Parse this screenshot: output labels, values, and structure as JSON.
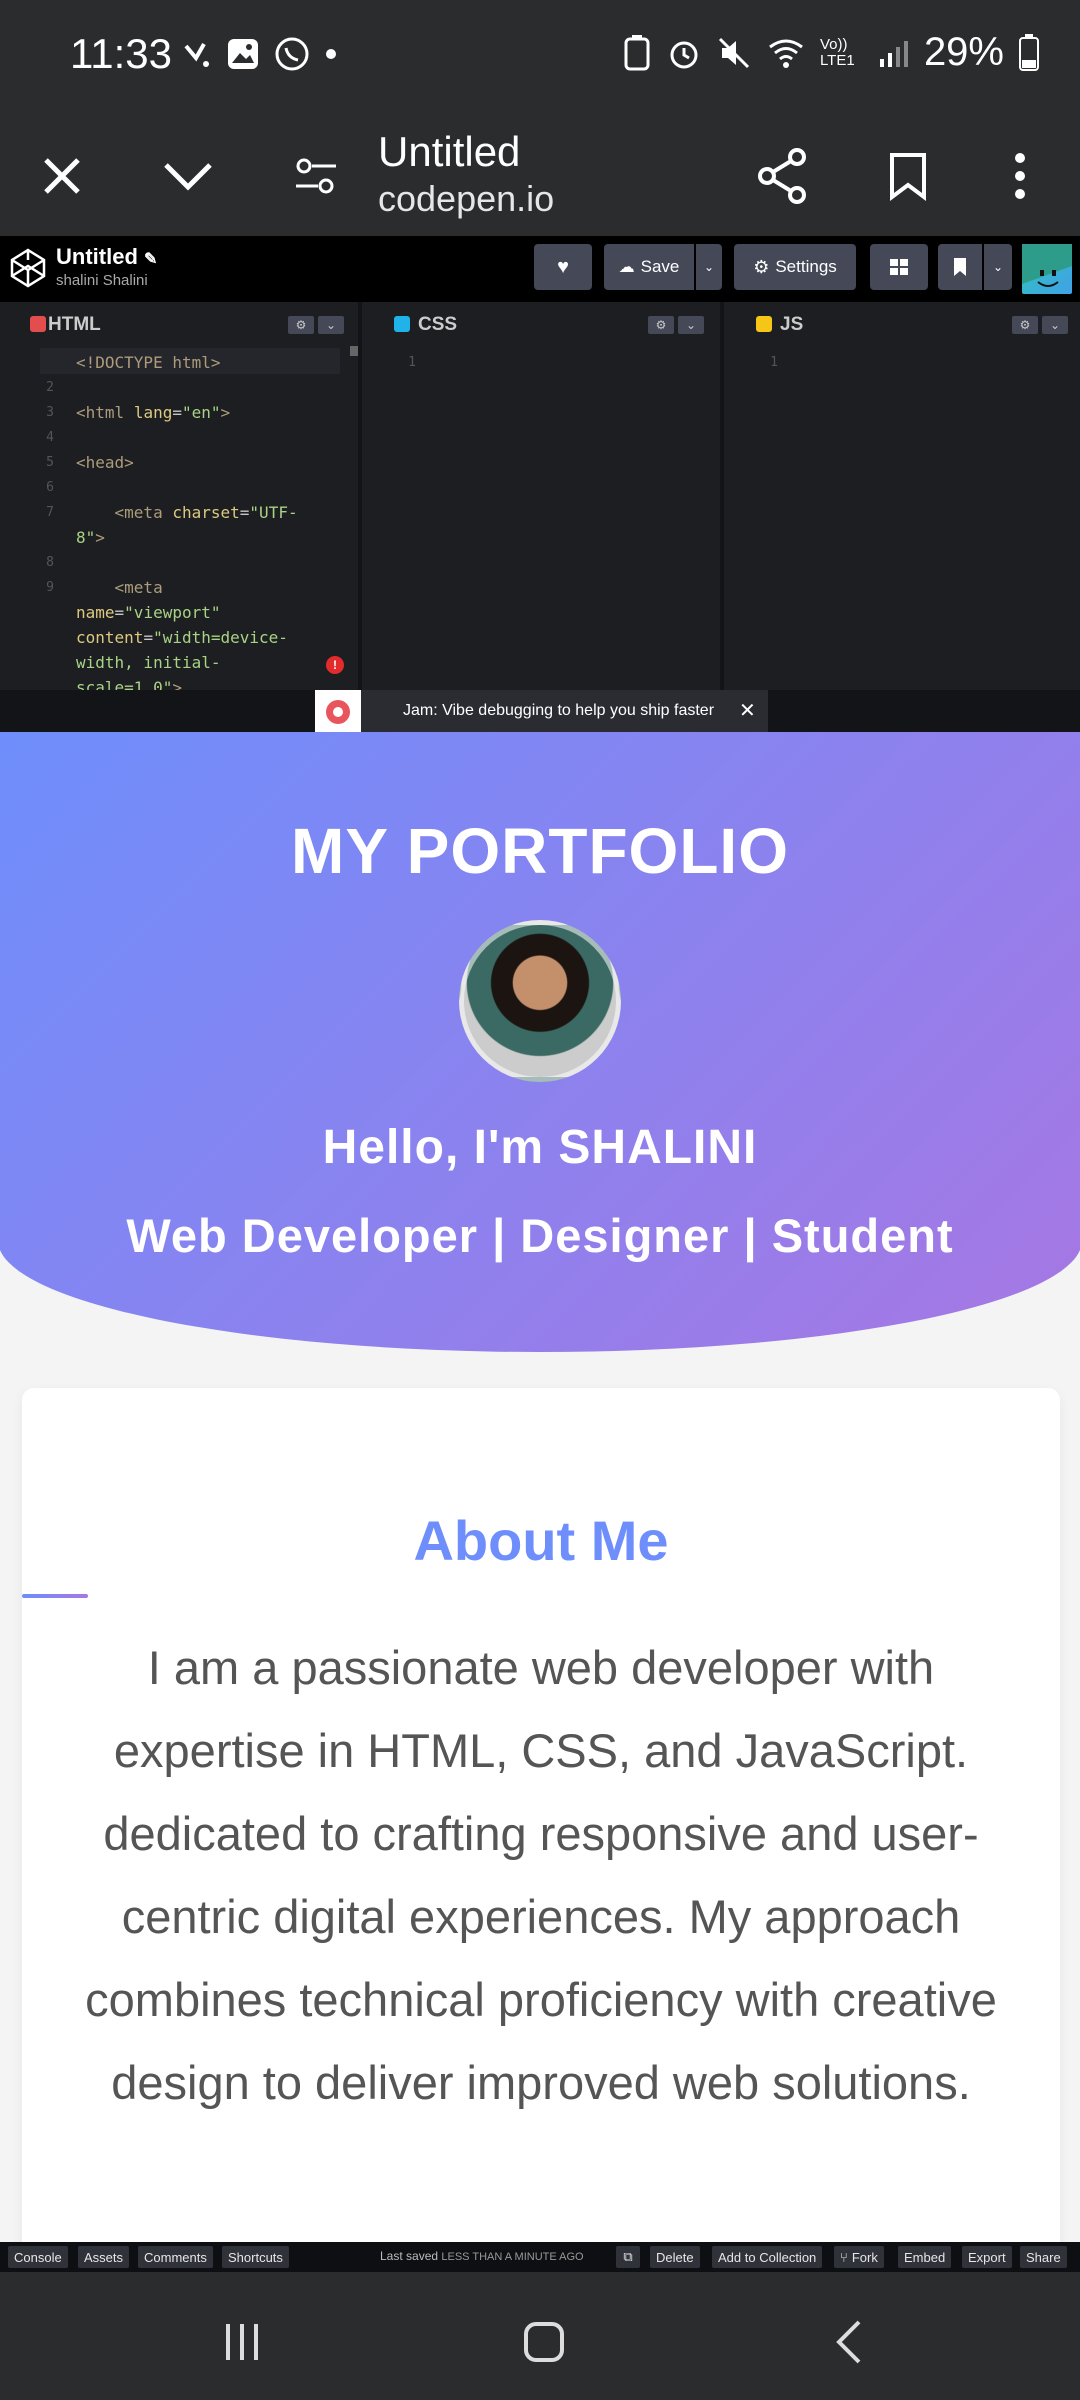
{
  "status": {
    "time": "11:33",
    "battery": "29%",
    "network": "Vo)) LTE1"
  },
  "browser": {
    "page_title": "Untitled",
    "domain": "codepen.io"
  },
  "codepen": {
    "title": "Untitled",
    "user": "shalini Shalini",
    "save_label": "Save",
    "settings_label": "Settings"
  },
  "editors": {
    "html_label": "HTML",
    "css_label": "CSS",
    "js_label": "JS",
    "html_gutter": "1\n2\n3\n4\n5\n6\n7\n\n8\n9",
    "css_gutter": "1",
    "js_gutter": "1"
  },
  "jam": {
    "text": "Jam: Vibe debugging to help you ship faster"
  },
  "preview": {
    "heading": "MY PORTFOLIO",
    "hello": "Hello, I'm SHALINI",
    "roles": "Web Developer | Designer | Student",
    "about_title": "About Me",
    "about_text": "I am a passionate web developer with expertise in HTML, CSS, and JavaScript. dedicated to crafting responsive and user-centric digital experiences. My approach combines technical proficiency with creative design to deliver improved web solutions."
  },
  "footer": {
    "console": "Console",
    "assets": "Assets",
    "comments": "Comments",
    "shortcuts": "Shortcuts",
    "saved_prefix": "Last saved",
    "saved_time": "LESS THAN A MINUTE AGO",
    "delete": "Delete",
    "add_collection": "Add to Collection",
    "fork": "Fork",
    "embed": "Embed",
    "export": "Export",
    "share": "Share"
  },
  "colors": {
    "gradient_start": "#6e8efb",
    "gradient_end": "#a777e3",
    "codepen_bg": "#1d1e22"
  }
}
